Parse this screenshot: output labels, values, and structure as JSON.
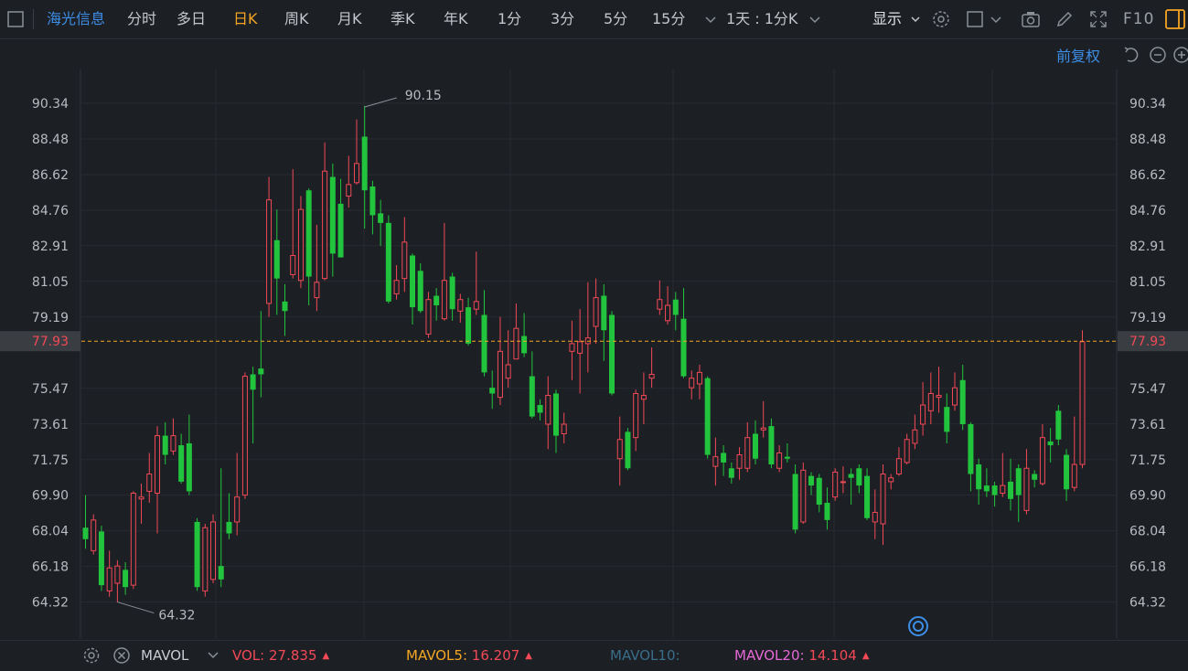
{
  "toolbar": {
    "stock_name": "海光信息",
    "periods": [
      "分时",
      "多日",
      "日K",
      "周K",
      "月K",
      "季K",
      "年K",
      "1分",
      "3分",
      "5分",
      "15分"
    ],
    "active_period": "日K",
    "combo_label": "1天 : 1分K",
    "display_label": "显示",
    "f10_label": "F10"
  },
  "adjust_label": "前复权",
  "price_axis": {
    "left_ticks": [
      "90.34",
      "88.48",
      "86.62",
      "84.76",
      "82.91",
      "81.05",
      "79.19",
      "77.93",
      "75.47",
      "73.61",
      "71.75",
      "69.90",
      "68.04",
      "66.18",
      "64.32"
    ],
    "right_ticks": [
      "90.34",
      "88.48",
      "86.62",
      "84.76",
      "82.91",
      "81.05",
      "79.19",
      "77.93",
      "75.47",
      "73.61",
      "71.75",
      "69.90",
      "68.04",
      "66.18",
      "64.32"
    ],
    "current_price": "77.93",
    "max_label": "90.15",
    "min_label": "64.32"
  },
  "chart_data": {
    "type": "candlestick",
    "ylim": [
      63.0,
      91.5
    ],
    "high_price": 90.15,
    "low_price": 64.32,
    "last_price": 77.93,
    "candles": [
      [
        68.2,
        67.6,
        69.9,
        67.1
      ],
      [
        67.0,
        68.6,
        68.9,
        66.8
      ],
      [
        68.0,
        65.2,
        68.3,
        64.9
      ],
      [
        64.9,
        66.1,
        67.0,
        64.6
      ],
      [
        65.3,
        66.2,
        66.5,
        64.3
      ],
      [
        66.0,
        65.1,
        66.4,
        64.7
      ],
      [
        65.2,
        70.0,
        70.1,
        65.0
      ],
      [
        69.7,
        69.8,
        70.5,
        68.4
      ],
      [
        70.1,
        71.0,
        72.1,
        69.5
      ],
      [
        70.0,
        73.0,
        73.5,
        67.9
      ],
      [
        73.0,
        72.0,
        73.7,
        71.5
      ],
      [
        72.2,
        73.0,
        73.9,
        72.0
      ],
      [
        72.5,
        70.6,
        73.1,
        70.5
      ],
      [
        72.6,
        70.1,
        74.1,
        69.9
      ],
      [
        68.5,
        65.1,
        68.7,
        64.9
      ],
      [
        64.9,
        68.2,
        68.4,
        64.6
      ],
      [
        65.5,
        68.5,
        68.9,
        65.3
      ],
      [
        66.2,
        65.5,
        71.3,
        65.1
      ],
      [
        68.5,
        67.9,
        70.0,
        67.6
      ],
      [
        68.5,
        69.8,
        72.1,
        67.8
      ],
      [
        69.9,
        76.1,
        76.3,
        69.7
      ],
      [
        76.2,
        75.4,
        76.6,
        72.6
      ],
      [
        76.5,
        76.2,
        79.5,
        75.0
      ],
      [
        79.9,
        85.3,
        86.5,
        79.2
      ],
      [
        83.2,
        81.2,
        84.8,
        79.3
      ],
      [
        80.0,
        79.5,
        80.9,
        78.2
      ],
      [
        81.4,
        82.4,
        86.9,
        81.2
      ],
      [
        81.1,
        84.8,
        85.5,
        80.7
      ],
      [
        85.8,
        81.3,
        85.9,
        79.8
      ],
      [
        80.2,
        81.0,
        84.0,
        79.5
      ],
      [
        81.2,
        86.8,
        88.3,
        81.1
      ],
      [
        86.5,
        82.5,
        87.2,
        81.3
      ],
      [
        85.1,
        82.3,
        86.4,
        82.3
      ],
      [
        85.5,
        86.1,
        87.6,
        84.9
      ],
      [
        86.2,
        87.2,
        89.5,
        86.1
      ],
      [
        88.6,
        85.8,
        90.2,
        83.8
      ],
      [
        86.0,
        84.5,
        86.3,
        83.5
      ],
      [
        84.6,
        84.1,
        85.3,
        82.9
      ],
      [
        84.1,
        80.0,
        84.5,
        79.9
      ],
      [
        80.4,
        81.1,
        81.9,
        80.1
      ],
      [
        81.2,
        83.1,
        84.4,
        80.5
      ],
      [
        82.4,
        79.7,
        82.5,
        78.8
      ],
      [
        81.6,
        79.5,
        82.0,
        79.4
      ],
      [
        78.3,
        80.1,
        80.5,
        78.1
      ],
      [
        80.3,
        79.8,
        80.7,
        79.0
      ],
      [
        79.1,
        81.1,
        84.1,
        79.0
      ],
      [
        81.3,
        79.6,
        81.5,
        79.0
      ],
      [
        79.5,
        80.1,
        80.4,
        78.9
      ],
      [
        79.7,
        77.8,
        80.2,
        77.7
      ],
      [
        79.6,
        80.0,
        82.6,
        79.3
      ],
      [
        79.3,
        76.3,
        80.6,
        76.1
      ],
      [
        75.5,
        75.2,
        76.4,
        74.4
      ],
      [
        75.0,
        77.4,
        79.2,
        74.6
      ],
      [
        76.0,
        76.7,
        78.5,
        75.5
      ],
      [
        77.0,
        78.6,
        79.9,
        77.1
      ],
      [
        78.2,
        77.3,
        79.4,
        77.1
      ],
      [
        76.1,
        74.0,
        77.4,
        73.9
      ],
      [
        74.6,
        74.2,
        74.9,
        73.8
      ],
      [
        73.6,
        75.1,
        76.1,
        72.3
      ],
      [
        75.2,
        73.0,
        75.4,
        72.1
      ],
      [
        73.1,
        73.6,
        74.2,
        72.6
      ],
      [
        77.4,
        77.8,
        79.0,
        75.9
      ],
      [
        77.3,
        77.9,
        79.6,
        75.2
      ],
      [
        77.8,
        78.1,
        81.0,
        76.3
      ],
      [
        78.7,
        80.2,
        81.2,
        77.8
      ],
      [
        80.3,
        78.5,
        80.9,
        76.9
      ],
      [
        79.3,
        75.2,
        79.5,
        75.1
      ],
      [
        71.8,
        72.8,
        74.0,
        70.4
      ],
      [
        73.2,
        71.3,
        73.4,
        71.2
      ],
      [
        72.9,
        75.2,
        75.4,
        72.2
      ],
      [
        74.9,
        75.1,
        76.3,
        73.6
      ],
      [
        76.0,
        76.2,
        77.6,
        75.5
      ],
      [
        79.6,
        80.1,
        81.1,
        79.3
      ],
      [
        79.0,
        79.8,
        80.8,
        78.8
      ],
      [
        80.1,
        79.3,
        80.5,
        78.5
      ],
      [
        79.1,
        76.1,
        80.7,
        76.0
      ],
      [
        75.5,
        76.0,
        76.4,
        74.9
      ],
      [
        75.7,
        76.3,
        76.7,
        74.9
      ],
      [
        76.0,
        72.0,
        76.1,
        71.8
      ],
      [
        71.4,
        71.9,
        72.9,
        70.4
      ],
      [
        72.1,
        71.6,
        72.5,
        70.9
      ],
      [
        71.3,
        70.8,
        71.6,
        70.5
      ],
      [
        71.3,
        72.0,
        72.4,
        70.7
      ],
      [
        71.3,
        72.9,
        73.7,
        71.1
      ],
      [
        73.1,
        71.8,
        73.8,
        71.5
      ],
      [
        73.3,
        73.4,
        74.8,
        72.9
      ],
      [
        73.5,
        71.5,
        73.9,
        71.3
      ],
      [
        71.3,
        72.1,
        72.5,
        71.1
      ],
      [
        71.9,
        71.8,
        72.6,
        71.6
      ],
      [
        71.0,
        68.1,
        71.5,
        67.9
      ],
      [
        68.5,
        71.2,
        71.6,
        68.4
      ],
      [
        70.9,
        70.4,
        71.1,
        69.9
      ],
      [
        70.8,
        69.4,
        71.0,
        69.0
      ],
      [
        69.5,
        68.6,
        70.3,
        68.1
      ],
      [
        69.8,
        71.1,
        71.3,
        69.6
      ],
      [
        70.6,
        70.6,
        71.4,
        70.0
      ],
      [
        71.0,
        70.8,
        71.3,
        69.4
      ],
      [
        71.3,
        70.4,
        71.5,
        70.0
      ],
      [
        70.9,
        68.7,
        71.3,
        68.6
      ],
      [
        68.5,
        69.0,
        70.2,
        67.6
      ],
      [
        68.4,
        71.0,
        71.5,
        67.3
      ],
      [
        70.6,
        70.8,
        71.0,
        70.2
      ],
      [
        71.0,
        71.8,
        72.4,
        70.9
      ],
      [
        71.6,
        72.8,
        73.1,
        71.5
      ],
      [
        72.6,
        73.3,
        74.1,
        72.3
      ],
      [
        73.6,
        74.6,
        75.8,
        73.0
      ],
      [
        74.3,
        75.2,
        76.3,
        73.6
      ],
      [
        75.0,
        75.1,
        76.6,
        74.2
      ],
      [
        74.5,
        73.2,
        75.2,
        72.6
      ],
      [
        74.6,
        75.5,
        76.3,
        74.3
      ],
      [
        75.9,
        73.6,
        76.7,
        73.3
      ],
      [
        73.6,
        71.0,
        73.7,
        70.1
      ],
      [
        71.5,
        70.2,
        71.8,
        69.4
      ],
      [
        70.4,
        70.1,
        71.3,
        69.8
      ],
      [
        70.4,
        69.9,
        70.6,
        69.3
      ],
      [
        70.0,
        70.4,
        72.1,
        69.8
      ],
      [
        70.6,
        69.7,
        71.8,
        69.1
      ],
      [
        71.3,
        69.9,
        71.5,
        68.5
      ],
      [
        69.1,
        71.3,
        72.3,
        68.9
      ],
      [
        71.0,
        70.7,
        71.2,
        70.3
      ],
      [
        70.5,
        72.9,
        73.6,
        70.4
      ],
      [
        72.7,
        72.5,
        73.4,
        71.6
      ],
      [
        74.3,
        72.8,
        74.6,
        72.5
      ],
      [
        72.0,
        70.2,
        72.3,
        69.6
      ],
      [
        70.3,
        71.5,
        74.0,
        70.1
      ],
      [
        71.5,
        77.9,
        78.5,
        71.3
      ]
    ]
  },
  "volume_bar": {
    "indicator": "MAVOL",
    "vol_label": "VOL:",
    "vol_value": "27.835",
    "mavol5_label": "MAVOL5:",
    "mavol5_value": "16.207",
    "mavol10_label": "MAVOL10:",
    "mavol20_label": "MAVOL20:",
    "mavol20_value": "14.104"
  },
  "colors": {
    "up": "#f24957",
    "down": "#22c43d",
    "accent": "#f5a623",
    "link": "#3d8ee6",
    "current_price": "#f24957",
    "mavol5": "#f5a623",
    "mavol10": "#3a6e8a",
    "mavol20": "#e668d6"
  }
}
